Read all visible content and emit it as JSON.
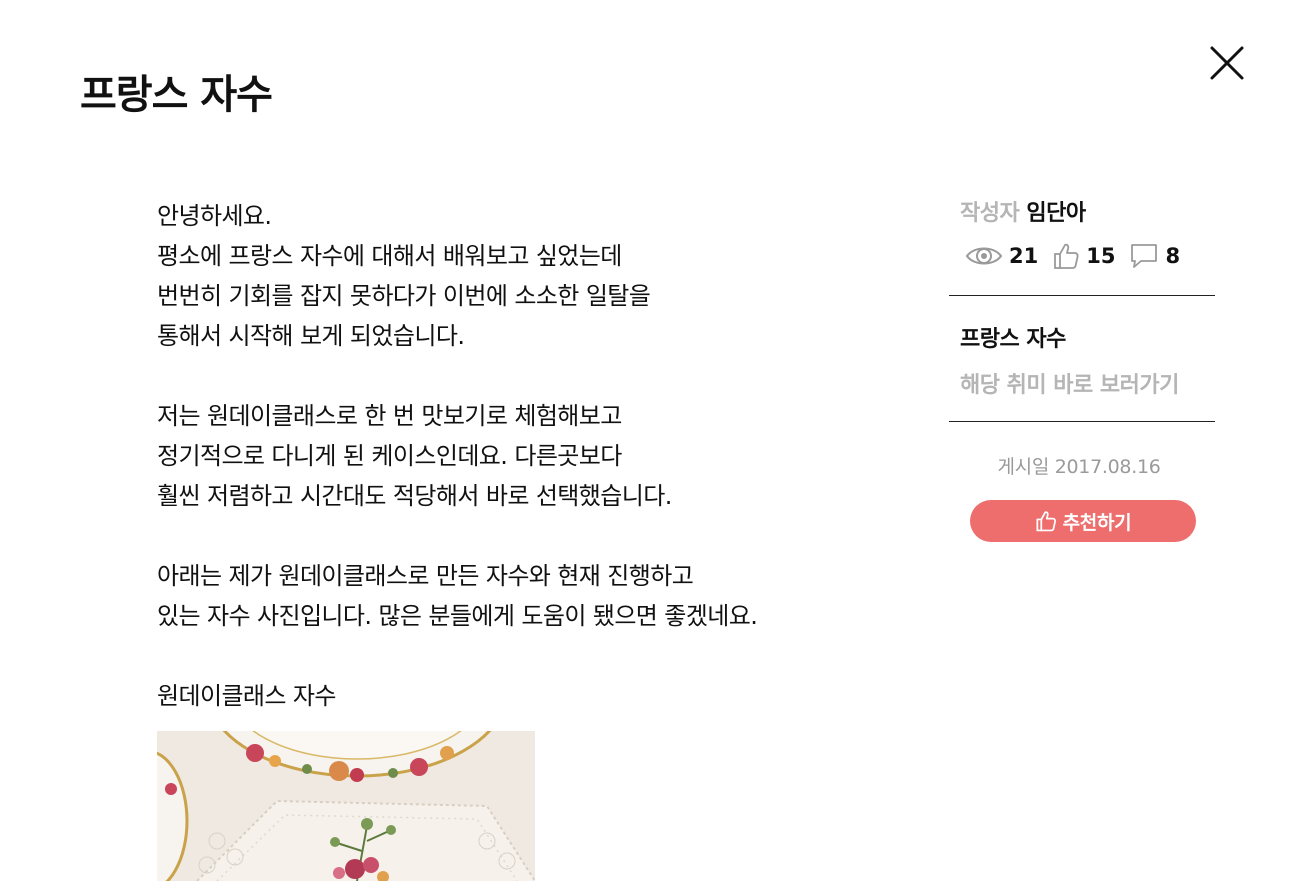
{
  "header": {
    "title": "프랑스 자수",
    "close_icon": "close-icon"
  },
  "article": {
    "paragraphs": [
      {
        "lines": [
          "안녕하세요.",
          "평소에 프랑스 자수에 대해서 배워보고 싶었는데",
          "번번히 기회를 잡지 못하다가 이번에 소소한 일탈을",
          "통해서 시작해 보게 되었습니다."
        ]
      },
      {
        "lines": [
          "저는 원데이클래스로 한 번 맛보기로 체험해보고",
          "정기적으로 다니게 된 케이스인데요. 다른곳보다",
          "훨씬 저렴하고 시간대도 적당해서 바로 선택했습니다."
        ]
      },
      {
        "lines": [
          "아래는 제가 원데이클래스로 만든 자수와 현재 진행하고",
          "있는 자수 사진입니다. 많은 분들에게 도움이 됐으면 좋겠네요."
        ]
      }
    ],
    "image_caption": "원데이클래스 자수",
    "image_subject": "floral embroidery on lace cloth with rose-pattern china"
  },
  "sidebar": {
    "author_label": "작성자",
    "author_name": "임단아",
    "stats": {
      "views": "21",
      "likes": "15",
      "comments": "8",
      "views_icon": "eye-icon",
      "likes_icon": "thumbs-up-icon",
      "comments_icon": "comment-icon"
    },
    "hobby_title": "프랑스 자수",
    "hobby_link": "해당 취미 바로 보러가기",
    "post_date": "게시일 2017.08.16",
    "recommend_button": "추천하기",
    "recommend_icon": "thumbs-up-icon"
  },
  "colors": {
    "accent": "#ee6e6e",
    "muted_text": "#b5b5b5",
    "date_text": "#9a9a9a",
    "text": "#111111",
    "divider": "#222222",
    "background": "#ffffff"
  }
}
